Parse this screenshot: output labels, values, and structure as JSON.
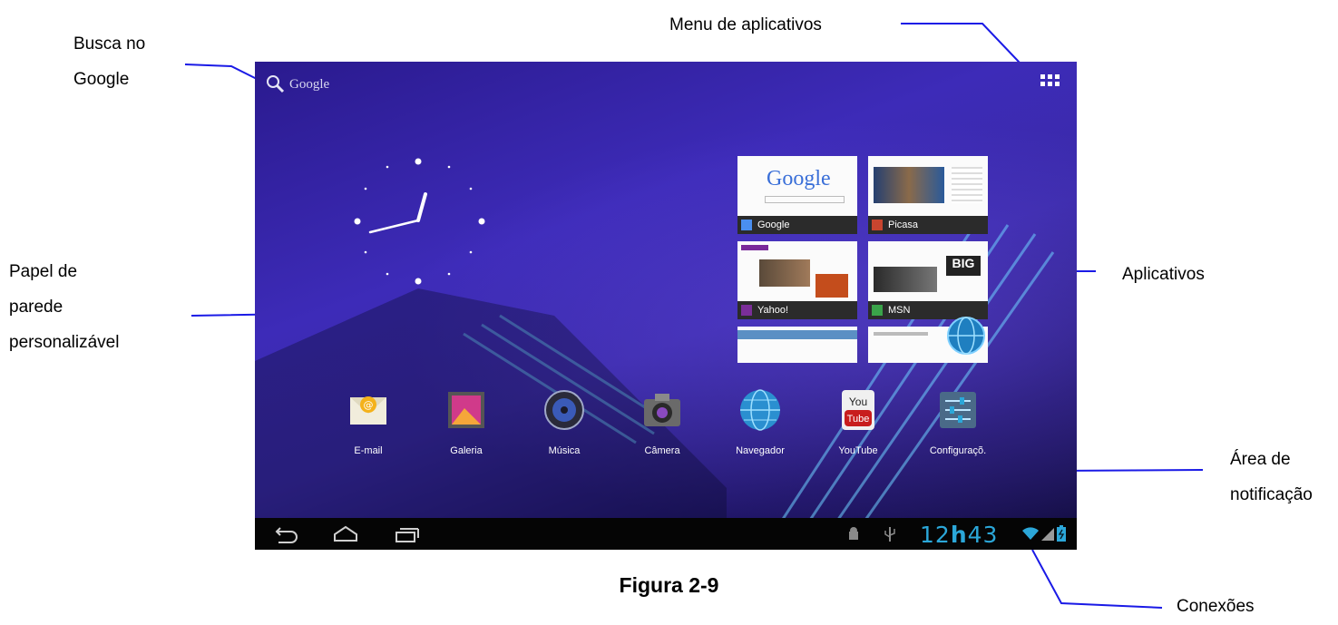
{
  "callouts": {
    "busca": [
      "Busca no",
      "Google"
    ],
    "menu": "Menu de aplicativos",
    "papel": [
      "Papel de",
      "parede",
      "personalizável"
    ],
    "aplicativos": "Aplicativos",
    "area": [
      "Área de",
      "notificação"
    ],
    "conexoes": "Conexões"
  },
  "caption": "Figura 2-9",
  "screen": {
    "search_label": "Google",
    "tiles": [
      {
        "name": "Google",
        "headline": "Google"
      },
      {
        "name": "Picasa"
      },
      {
        "name": "Yahoo!"
      },
      {
        "name": "MSN"
      }
    ],
    "dock": [
      {
        "label": "E-mail",
        "icon": "email-icon"
      },
      {
        "label": "Galeria",
        "icon": "gallery-icon"
      },
      {
        "label": "Música",
        "icon": "music-icon"
      },
      {
        "label": "Câmera",
        "icon": "camera-icon"
      },
      {
        "label": "Navegador",
        "icon": "browser-icon"
      },
      {
        "label": "YouTube",
        "icon": "youtube-icon",
        "badge": [
          "You",
          "Tube"
        ]
      },
      {
        "label": "Configuraçõ.",
        "icon": "settings-icon"
      }
    ],
    "status": {
      "time_hours": "12",
      "time_sep": "h",
      "time_minutes": "43"
    },
    "colors": {
      "accent": "#2ba7d9",
      "wallpaper": "#3d2bb8",
      "navbar": "#050505"
    }
  }
}
